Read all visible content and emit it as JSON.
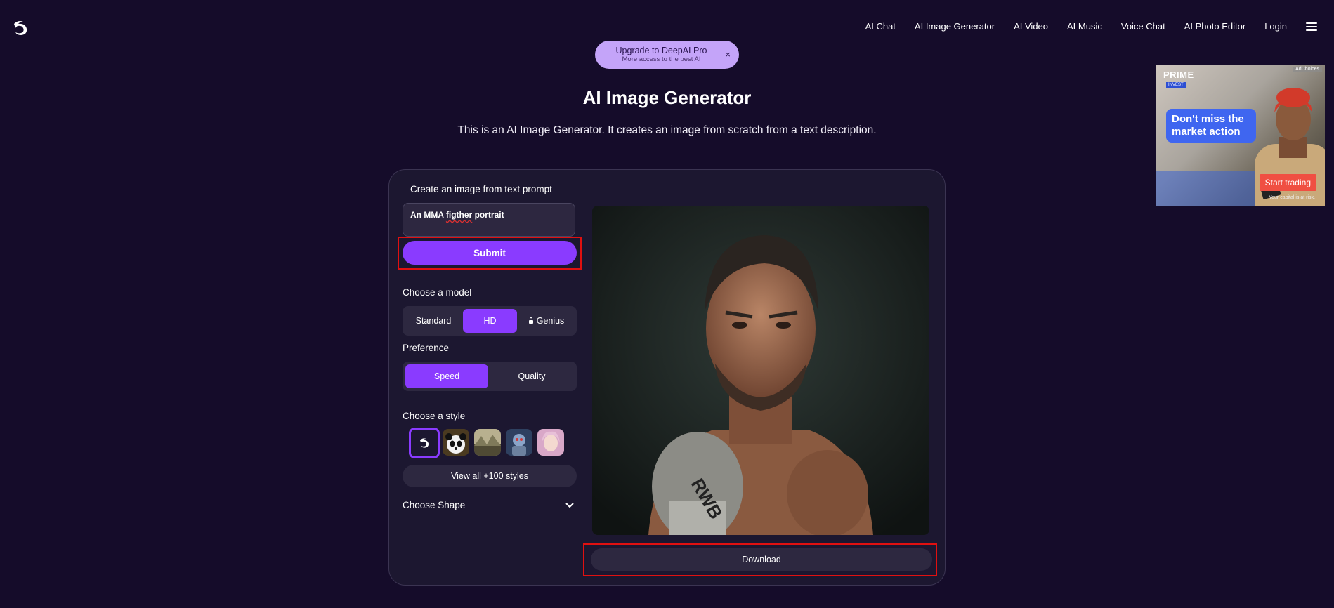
{
  "nav": {
    "items": [
      "AI Chat",
      "AI Image Generator",
      "AI Video",
      "AI Music",
      "Voice Chat",
      "AI Photo Editor",
      "Login"
    ]
  },
  "promo": {
    "title": "Upgrade to DeepAI Pro",
    "subtitle": "More access to the best AI",
    "close": "×"
  },
  "page": {
    "title": "AI Image Generator",
    "subtitle": "This is an AI Image Generator. It creates an image from scratch from a text description."
  },
  "ad": {
    "brand": "PRIME",
    "brand_sub": "INVEST",
    "adchoices": "AdChoices",
    "headline": "Don't miss the market action",
    "cta": "Start trading",
    "fineprint": "Your capital is at risk."
  },
  "form": {
    "create_label": "Create an image from text prompt",
    "prompt_prefix": "An MMA ",
    "prompt_misspelled": "figther",
    "prompt_suffix": " portrait",
    "submit_label": "Submit",
    "model_label": "Choose a model",
    "models": [
      "Standard",
      "HD",
      "Genius"
    ],
    "selected_model": "HD",
    "preference_label": "Preference",
    "preferences": [
      "Speed",
      "Quality"
    ],
    "selected_preference": "Speed",
    "style_label": "Choose a style",
    "view_all_label": "View all +100 styles",
    "shape_label": "Choose Shape"
  },
  "result": {
    "download_label": "Download",
    "glove_text": "RWB"
  },
  "colors": {
    "background": "#150c2a",
    "accent": "#8a3bff",
    "panel": "#1c1730",
    "highlight": "#e01010"
  }
}
